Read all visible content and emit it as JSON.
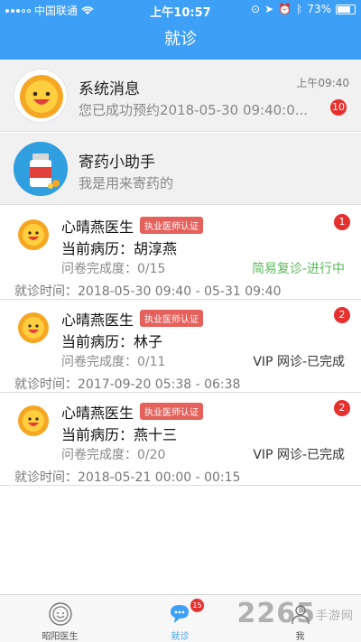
{
  "status_bar": {
    "carrier": "中国联通",
    "time": "上午10:57",
    "battery": "73%"
  },
  "header": {
    "title": "就诊"
  },
  "system_message": {
    "title": "系统消息",
    "subtitle": "您已成功预约2018-05-30 09:40:0...",
    "time": "上午09:40",
    "badge": "10"
  },
  "assistant": {
    "title": "寄药小助手",
    "subtitle": "我是用来寄药的"
  },
  "cases": [
    {
      "doctor": "心晴燕医生",
      "cert": "执业医师认证",
      "record": "当前病历：胡淳燕",
      "progress": "问卷完成度：0/15",
      "status": "简易复诊-进行中",
      "status_color": "#5cb85c",
      "time": "就诊时间：2018-05-30 09:40 - 05-31 09:40",
      "badge": "1"
    },
    {
      "doctor": "心晴燕医生",
      "cert": "执业医师认证",
      "record": "当前病历：林子",
      "progress": "问卷完成度：0/11",
      "status": "VIP 网诊-已完成",
      "status_color": "#333333",
      "time": "就诊时间：2017-09-20 05:38 - 06:38",
      "badge": "2"
    },
    {
      "doctor": "心晴燕医生",
      "cert": "执业医师认证",
      "record": "当前病历：燕十三",
      "progress": "问卷完成度：0/20",
      "status": "VIP 网诊-已完成",
      "status_color": "#333333",
      "time": "就诊时间：2018-05-21 00:00 - 00:15",
      "badge": "2"
    }
  ],
  "tabs": [
    {
      "label": "昭阳医生",
      "icon": "sun-face-icon"
    },
    {
      "label": "就诊",
      "icon": "chat-bubble-icon",
      "badge": "15",
      "active": true
    },
    {
      "label": "我",
      "icon": "person-icon"
    }
  ],
  "watermark": {
    "text": "2265",
    "sub": "手游网"
  },
  "colors": {
    "primary": "#3d9ff5",
    "badge": "#e5302d",
    "cert": "#e5615c",
    "in_progress": "#5cb85c"
  }
}
